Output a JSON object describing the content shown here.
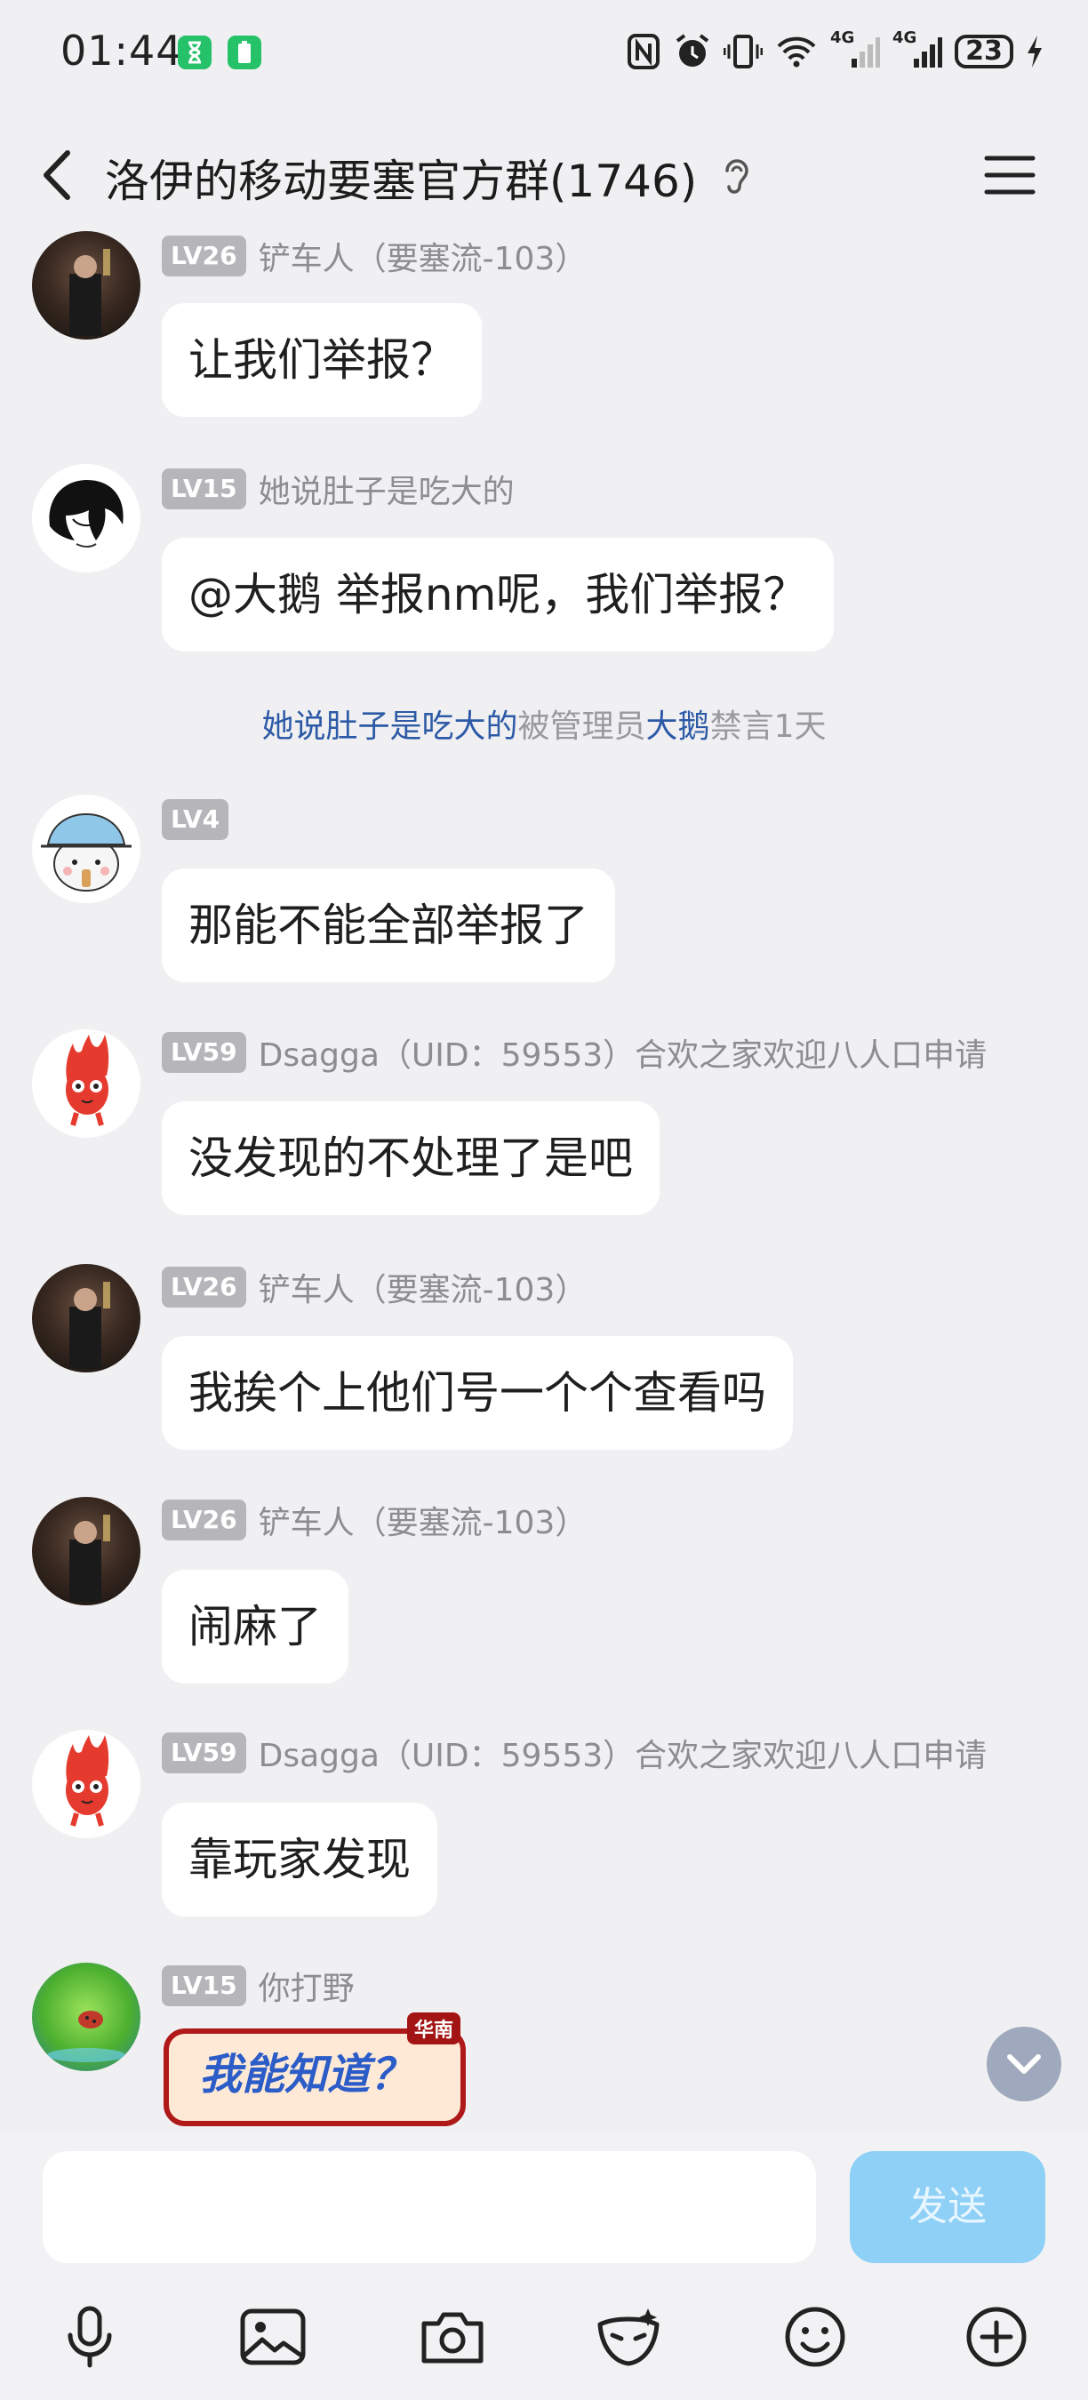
{
  "status_bar": {
    "time": "01:44",
    "battery": "23",
    "signal_labels": [
      "4G",
      "4G"
    ]
  },
  "header": {
    "title": "洛伊的移动要塞官方群(1746)"
  },
  "messages": [
    {
      "level": "LV26",
      "nickname": "铲车人（要塞流-103）",
      "text": "让我们举报？"
    },
    {
      "level": "LV15",
      "nickname": "她说肚子是吃大的",
      "text": "@大鹅 举报nm呢，我们举报？"
    },
    {
      "level": "LV4",
      "nickname": "",
      "text": "那能不能全部举报了"
    },
    {
      "level": "LV59",
      "nickname": "Dsagga（UID：59553）合欢之家欢迎八人口申请",
      "text": "没发现的不处理了是吧"
    },
    {
      "level": "LV26",
      "nickname": "铲车人（要塞流-103）",
      "text": "我挨个上他们号一个个查看吗"
    },
    {
      "level": "LV26",
      "nickname": "铲车人（要塞流-103）",
      "text": "闹麻了"
    },
    {
      "level": "LV59",
      "nickname": "Dsagga（UID：59553）合欢之家欢迎八人口申请",
      "text": "靠玩家发现"
    },
    {
      "level": "LV15",
      "nickname": "你打野",
      "text": ""
    }
  ],
  "system_notice": {
    "user": "她说肚子是吃大的",
    "action": "被管理员",
    "admin": "大鹅",
    "result": "禁言1天"
  },
  "sticker": {
    "text": "我能知道？",
    "tag": "华南"
  },
  "input": {
    "value": "",
    "send_label": "发送"
  },
  "toolbar_icons": [
    "microphone-icon",
    "image-icon",
    "camera-icon",
    "mask-effect-icon",
    "emoji-icon",
    "plus-icon"
  ],
  "colors": {
    "background": "#f0f0f2",
    "bubble": "#ffffff",
    "link": "#2d5aa6",
    "send_button": "#8fd0f7",
    "level_badge": "#b6b6ba"
  }
}
